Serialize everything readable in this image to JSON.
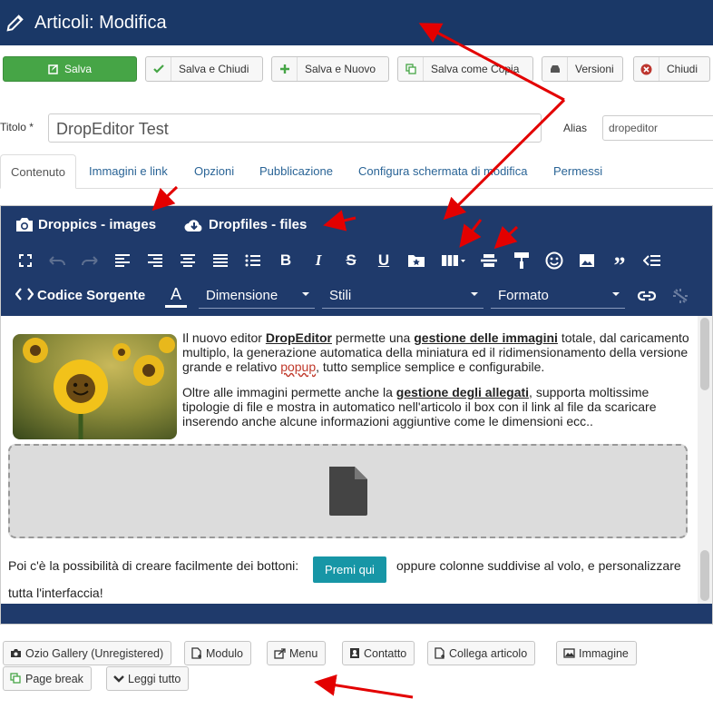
{
  "header": {
    "title": "Articoli: Modifica"
  },
  "toolbar": {
    "save": "Salva",
    "save_close": "Salva e Chiudi",
    "save_new": "Salva e Nuovo",
    "save_copy": "Salva come Copia",
    "versions": "Versioni",
    "close": "Chiudi"
  },
  "form": {
    "title_label": "Titolo *",
    "title_value": "DropEditor Test",
    "alias_label": "Alias",
    "alias_value": "dropeditor"
  },
  "tabs": [
    "Contenuto",
    "Immagini e link",
    "Opzioni",
    "Pubblicazione",
    "Configura schermata di modifica",
    "Permessi"
  ],
  "editor": {
    "droppics": "Droppics - images",
    "dropfiles": "Dropfiles - files",
    "source": "Codice Sorgente",
    "selects": [
      "Dimensione",
      "Stili",
      "Formato"
    ],
    "para1": {
      "t1": "Il nuovo editor ",
      "b1": "DropEditor",
      "t2": " permette una ",
      "b2": "gestione delle immagini",
      "t3": " totale, dal caricamento multiplo, la generazione automatica della miniatura ed il ridimensionamento della versione grande e relativo ",
      "popup": "popup",
      "t4": ", tutto semplice semplice e configurabile."
    },
    "para2": {
      "t1": "Oltre alle immagini permette anche la ",
      "b1": "gestione degli allegati",
      "t2": ", supporta moltissime tipologie di file e mostra in automatico nell'articolo il box con il link al file da scaricare inserendo anche alcune informazioni aggiuntive come le dimensioni ecc.."
    },
    "line3": "Poi c'è la possibilità di creare facilmente dei bottoni:",
    "button_label": "Premi qui",
    "line3b": "oppure colonne suddivise al volo, e personalizzare",
    "line4": "tutta l'interfaccia!"
  },
  "bottom_buttons": [
    "Ozio Gallery (Unregistered)",
    "Modulo",
    "Menu",
    "Contatto",
    "Collega articolo",
    "Immagine",
    "Page break",
    "Leggi tutto"
  ],
  "colors": {
    "header": "#1a3867",
    "editor_bar": "#1f3a6b",
    "save_green": "#46a546",
    "accent_teal": "#1796a6",
    "arrow_red": "#e30000"
  }
}
